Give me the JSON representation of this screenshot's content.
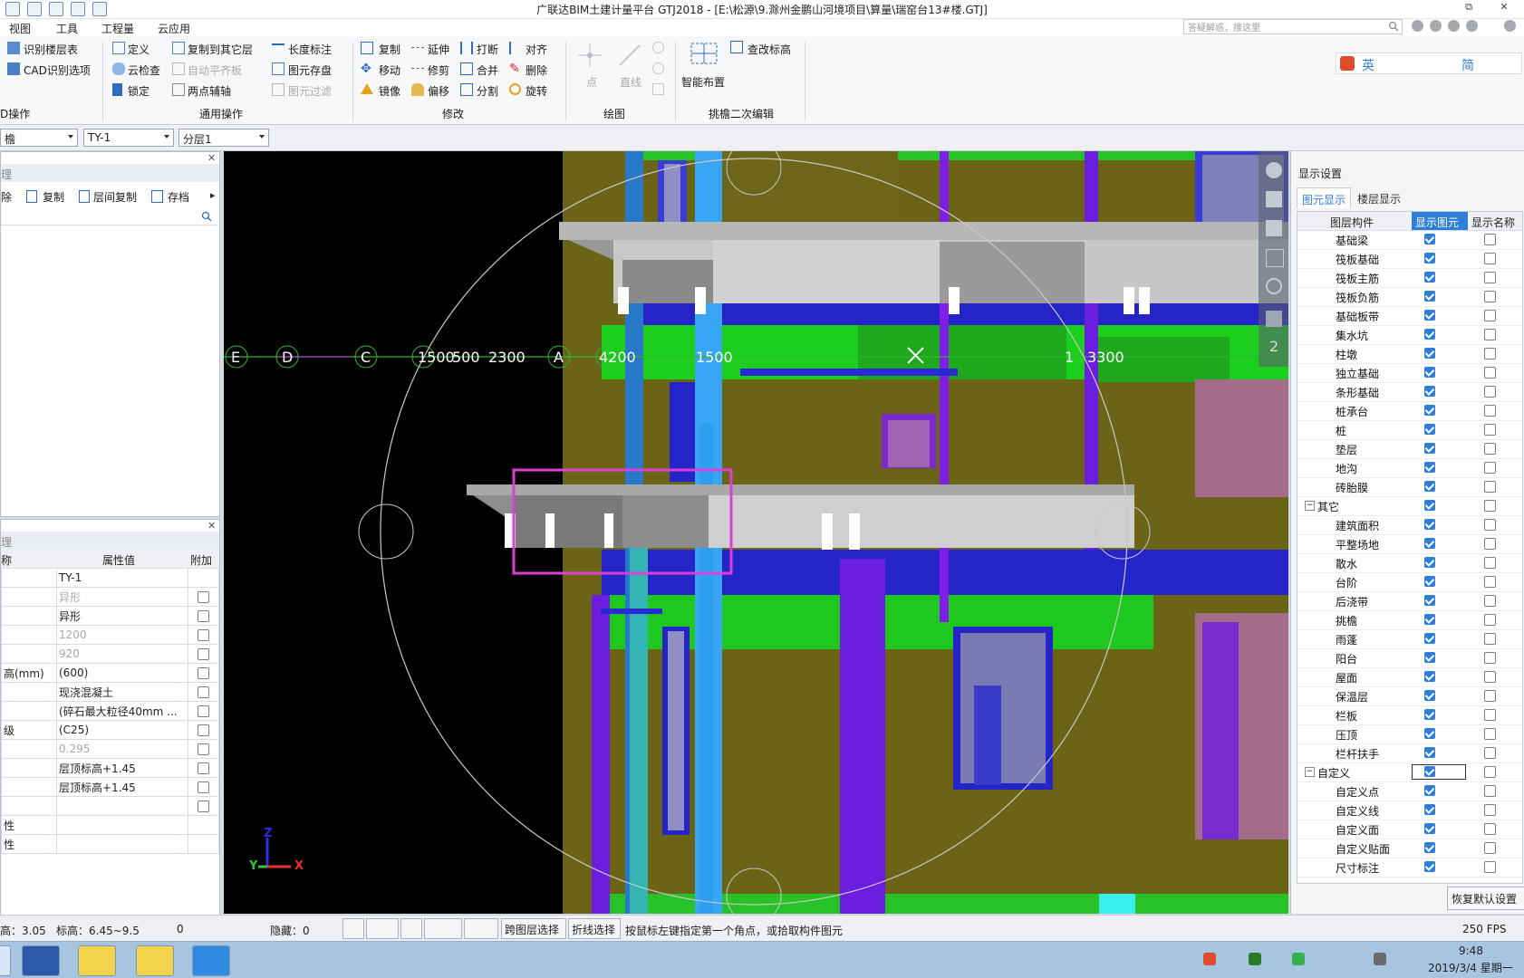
{
  "window": {
    "title": "广联达BIM土建计量平台 GTJ2018 - [E:\\松源\\9.滁州金鹏山河境项目\\算量\\瑞窑台13#楼.GTJ]",
    "controls": [
      "▭",
      "⧉",
      "✕"
    ]
  },
  "menu": [
    "视图",
    "工具",
    "工程量",
    "云应用"
  ],
  "search": {
    "placeholder": "答疑解惑，搜这里"
  },
  "ribbon": {
    "cad": {
      "items": [
        "识别楼层表",
        "CAD识别选项"
      ],
      "group": "D操作"
    },
    "common": {
      "items": [
        "定义",
        "云检查",
        "锁定",
        "复制到其它层",
        "自动平齐板",
        "两点辅轴",
        "长度标注",
        "图元存盘",
        "图元过滤"
      ],
      "group": "通用操作"
    },
    "modify": {
      "items": [
        "复制",
        "移动",
        "镜像",
        "延伸",
        "修剪",
        "偏移",
        "打断",
        "合并",
        "分割",
        "对齐",
        "删除",
        "旋转"
      ],
      "group": "修改"
    },
    "draw": {
      "items": [
        "点",
        "直线"
      ],
      "group": "绘图"
    },
    "secondary": {
      "items": [
        "智能布置",
        "查改标高"
      ],
      "group": "挑檐二次编辑"
    }
  },
  "ime_toolbar": [
    "英",
    "简"
  ],
  "combos": [
    "檐",
    "TY-1",
    "分层1"
  ],
  "left_top_panel": {
    "header": "理",
    "buttons": [
      "除",
      "复制",
      "层间复制",
      "存档"
    ]
  },
  "property_panel": {
    "header": "理",
    "columns": [
      "称",
      "属性值",
      "附加"
    ],
    "rows": [
      {
        "name": "",
        "value": "TY-1",
        "grey": false,
        "check": false
      },
      {
        "name": "",
        "value": "异形",
        "grey": true,
        "check": true
      },
      {
        "name": "",
        "value": "异形",
        "grey": false,
        "check": true
      },
      {
        "name": "",
        "value": "1200",
        "grey": true,
        "check": true
      },
      {
        "name": "",
        "value": "920",
        "grey": true,
        "check": true
      },
      {
        "name": "高(mm)",
        "value": "(600)",
        "grey": false,
        "check": true
      },
      {
        "name": "",
        "value": "现浇混凝土",
        "grey": false,
        "check": true
      },
      {
        "name": "",
        "value": "(碎石最大粒径40mm ...",
        "grey": false,
        "check": true
      },
      {
        "name": "级",
        "value": "(C25)",
        "grey": false,
        "check": true
      },
      {
        "name": "",
        "value": "0.295",
        "grey": true,
        "check": true
      },
      {
        "name": "",
        "value": "层顶标高+1.45",
        "grey": false,
        "check": true
      },
      {
        "name": "",
        "value": "层顶标高+1.45",
        "grey": false,
        "check": true
      },
      {
        "name": "",
        "value": "",
        "grey": false,
        "check": true
      },
      {
        "name": "性",
        "value": "",
        "grey": false,
        "check": false
      },
      {
        "name": "性",
        "value": "",
        "grey": false,
        "check": false
      }
    ]
  },
  "viewport": {
    "axis_labels": [
      "E",
      "D",
      "C",
      "1500",
      "500",
      "2300",
      "A",
      "4200",
      "1500",
      "1",
      "3300"
    ],
    "axes": [
      "Z",
      "Y",
      "X"
    ],
    "page_number": "2"
  },
  "display_panel": {
    "title": "显示设置",
    "tabs": [
      "图元显示",
      "楼层显示"
    ],
    "columns": [
      "图层构件",
      "显示图元",
      "显示名称"
    ],
    "rows": [
      {
        "label": "基础梁",
        "group": false,
        "show": true
      },
      {
        "label": "筏板基础",
        "group": false,
        "show": true
      },
      {
        "label": "筏板主筋",
        "group": false,
        "show": true
      },
      {
        "label": "筏板负筋",
        "group": false,
        "show": true
      },
      {
        "label": "基础板带",
        "group": false,
        "show": true
      },
      {
        "label": "集水坑",
        "group": false,
        "show": true
      },
      {
        "label": "柱墩",
        "group": false,
        "show": true
      },
      {
        "label": "独立基础",
        "group": false,
        "show": true
      },
      {
        "label": "条形基础",
        "group": false,
        "show": true
      },
      {
        "label": "桩承台",
        "group": false,
        "show": true
      },
      {
        "label": "桩",
        "group": false,
        "show": true
      },
      {
        "label": "垫层",
        "group": false,
        "show": true
      },
      {
        "label": "地沟",
        "group": false,
        "show": true
      },
      {
        "label": "砖胎膜",
        "group": false,
        "show": true
      },
      {
        "label": "其它",
        "group": true,
        "show": true
      },
      {
        "label": "建筑面积",
        "group": false,
        "show": true
      },
      {
        "label": "平整场地",
        "group": false,
        "show": true
      },
      {
        "label": "散水",
        "group": false,
        "show": true
      },
      {
        "label": "台阶",
        "group": false,
        "show": true
      },
      {
        "label": "后浇带",
        "group": false,
        "show": true
      },
      {
        "label": "挑檐",
        "group": false,
        "show": true
      },
      {
        "label": "雨蓬",
        "group": false,
        "show": true
      },
      {
        "label": "阳台",
        "group": false,
        "show": true
      },
      {
        "label": "屋面",
        "group": false,
        "show": true
      },
      {
        "label": "保温层",
        "group": false,
        "show": true
      },
      {
        "label": "栏板",
        "group": false,
        "show": true
      },
      {
        "label": "压顶",
        "group": false,
        "show": true
      },
      {
        "label": "栏杆扶手",
        "group": false,
        "show": true
      },
      {
        "label": "自定义",
        "group": true,
        "show": false
      },
      {
        "label": "自定义点",
        "group": false,
        "show": true
      },
      {
        "label": "自定义线",
        "group": false,
        "show": true
      },
      {
        "label": "自定义面",
        "group": false,
        "show": true
      },
      {
        "label": "自定义贴面",
        "group": false,
        "show": true
      },
      {
        "label": "尺寸标注",
        "group": false,
        "show": true
      }
    ],
    "restore_button": "恢复默认设置"
  },
  "status": {
    "left": "高：3.05",
    "elev": "标高：6.45~9.5",
    "zero": "0",
    "hidden": "隐藏：0",
    "btn_cross_layer": "跨图层选择",
    "btn_polyline": "折线选择",
    "hint": "按鼠标左键指定第一个角点，或拾取构件图元",
    "fps": "250 FPS"
  },
  "clock": {
    "time": "9:48",
    "date": "2019/3/4 星期一"
  },
  "colors": {
    "accent": "#2f7ed8",
    "selection": "#e03cd6",
    "slab": "#6b6417",
    "wall": "#2424c8"
  }
}
